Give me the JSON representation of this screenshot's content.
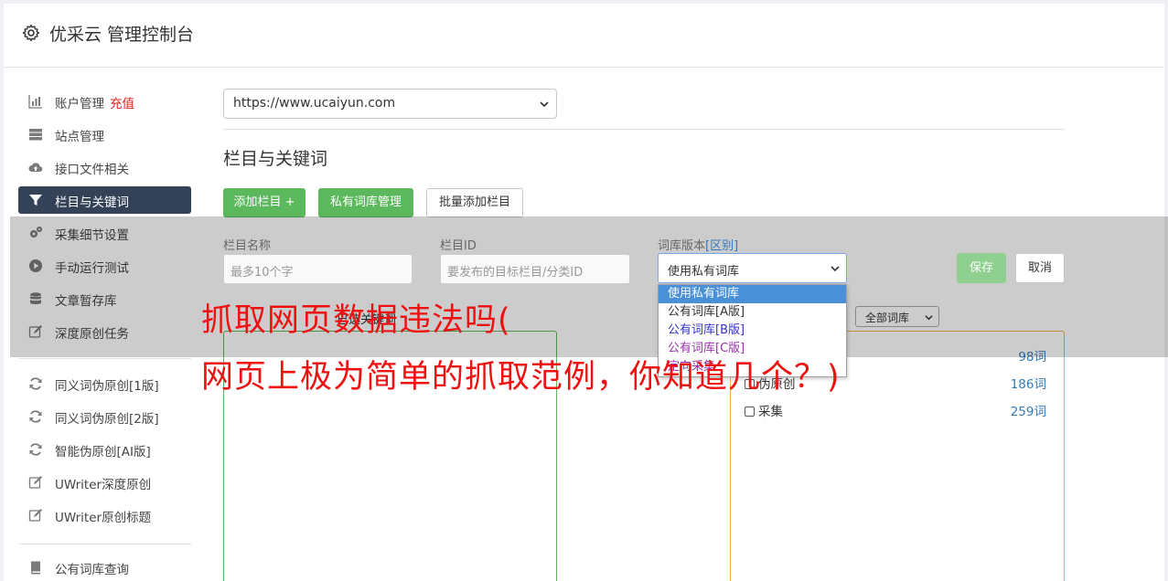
{
  "header": {
    "title": "优采云 管理控制台"
  },
  "sidebar": {
    "items": [
      {
        "label": "账户管理",
        "extra": "充值",
        "icon": "bar-chart-icon"
      },
      {
        "label": "站点管理",
        "icon": "server-icon"
      },
      {
        "label": "接口文件相关",
        "icon": "cloud-upload-icon"
      },
      {
        "label": "栏目与关键词",
        "icon": "filter-icon",
        "active": true
      },
      {
        "label": "采集细节设置",
        "icon": "cogs-icon"
      },
      {
        "label": "手动运行测试",
        "icon": "play-circle-icon"
      },
      {
        "label": "文章暂存库",
        "icon": "database-icon"
      },
      {
        "label": "深度原创任务",
        "icon": "edit-icon"
      },
      {
        "label": "同义词伪原创[1版]",
        "icon": "refresh-icon"
      },
      {
        "label": "同义词伪原创[2版]",
        "icon": "refresh-icon"
      },
      {
        "label": "智能伪原创[AI版]",
        "icon": "refresh-icon"
      },
      {
        "label": "UWriter深度原创",
        "icon": "edit-icon"
      },
      {
        "label": "UWriter原创标题",
        "icon": "edit-icon"
      },
      {
        "label": "公有词库查询",
        "icon": "book-icon"
      }
    ]
  },
  "site_select": {
    "value": "https://www.ucaiyun.com"
  },
  "section_title": "栏目与关键词",
  "toolbar": {
    "add_column": "添加栏目 +",
    "private_lib": "私有词库管理",
    "batch_add": "批量添加栏目"
  },
  "form": {
    "name_label": "栏目名称",
    "name_placeholder": "最多10个字",
    "id_label": "栏目ID",
    "id_placeholder": "要发布的目标栏目/分类ID",
    "version_label": "词库版本",
    "version_link": "[区别]",
    "version_value": "使用私有词库",
    "save": "保存",
    "cancel": "取消"
  },
  "dropdown": {
    "options": [
      "使用私有词库",
      "公有词库[A版]",
      "公有词库[B版]",
      "公有词库[C版]",
      "定向采集"
    ]
  },
  "library_filter": {
    "value": "全部词库"
  },
  "library_rows": [
    {
      "label": "",
      "count": "98词"
    },
    {
      "label": "伪原创",
      "count": "186词"
    },
    {
      "label": "采集",
      "count": "259词"
    }
  ],
  "behind_text": "已选关键词",
  "watermark": {
    "line1": "抓取网页数据违法吗(",
    "line2": "网页上极为简单的抓取范例，你知道几个？)"
  },
  "colors": {
    "green": "#5cb85c",
    "active_nav": "#344258",
    "red": "#ee1111",
    "link": "#337ab7"
  }
}
